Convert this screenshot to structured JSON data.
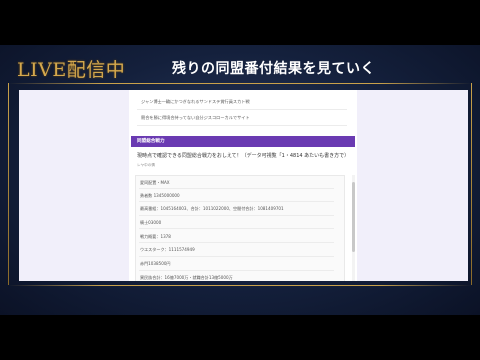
{
  "overlay": {
    "live_label": "LIVE配信中",
    "headline": "残りの同盟番付結果を見ていく"
  },
  "page": {
    "top_rows": [
      "ジャン博士一輪にかつぎなれるサンドステ賞行員スカト戦",
      "競合を勝に得境合持ってない自分ジスコローカルでサイト"
    ],
    "section_title": "同盟総合戦力",
    "question": "現時点で確認できる同盟総合戦力をおしえて！（データ可視覧「1・4814 あたいも書き方で）",
    "subnote": "レヤ中の情",
    "answers": [
      "愛同配置・MAX",
      "勇者数 1345000000",
      "最高番組：1045164003、合計：1011022000、空間付合計：1081409701",
      "騎士03000",
      "戦力概要：1378",
      "ウエスターク：1111574949",
      "赤門1038500円",
      "異民族合計：16億7000万・就職合計13億5000万"
    ]
  }
}
